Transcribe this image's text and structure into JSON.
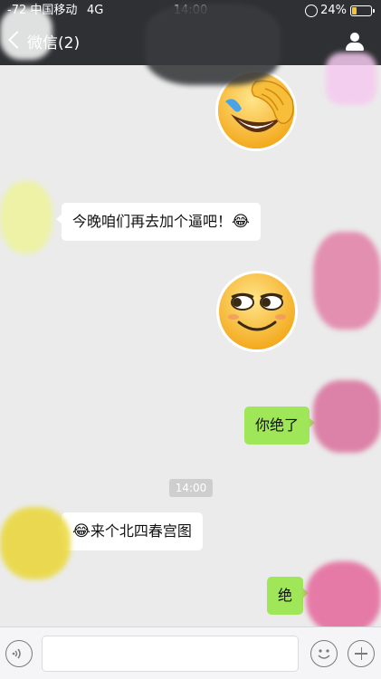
{
  "status_bar": {
    "carrier": "-72 中国移动",
    "network": "4G",
    "time": "14:00",
    "battery_percent": "24%",
    "battery_level": 0.24
  },
  "nav": {
    "title": "微信(2)"
  },
  "messages": [
    {
      "side": "right",
      "type": "sticker",
      "sticker": "facepalm-laugh-emoji"
    },
    {
      "side": "left",
      "type": "text",
      "text": "今晚咱们再去加个逼吧！",
      "emoji": "😂"
    },
    {
      "side": "right",
      "type": "sticker",
      "sticker": "smirk-emoji"
    },
    {
      "side": "right",
      "type": "text",
      "text": "你绝了"
    },
    {
      "side": "center",
      "type": "timestamp",
      "text": "14:00"
    },
    {
      "side": "left",
      "type": "text",
      "text": "来个北四春宫图",
      "emoji": "😂"
    },
    {
      "side": "right",
      "type": "text",
      "text": "绝"
    }
  ],
  "input_bar": {
    "voice_icon": "voice-icon",
    "emoji_icon": "emoji-icon",
    "plus_icon": "plus-icon"
  },
  "colors": {
    "nav_bg": "#2e3033",
    "chat_bg": "#ebebeb",
    "sent_bubble": "#9fe658",
    "received_bubble": "#ffffff"
  }
}
